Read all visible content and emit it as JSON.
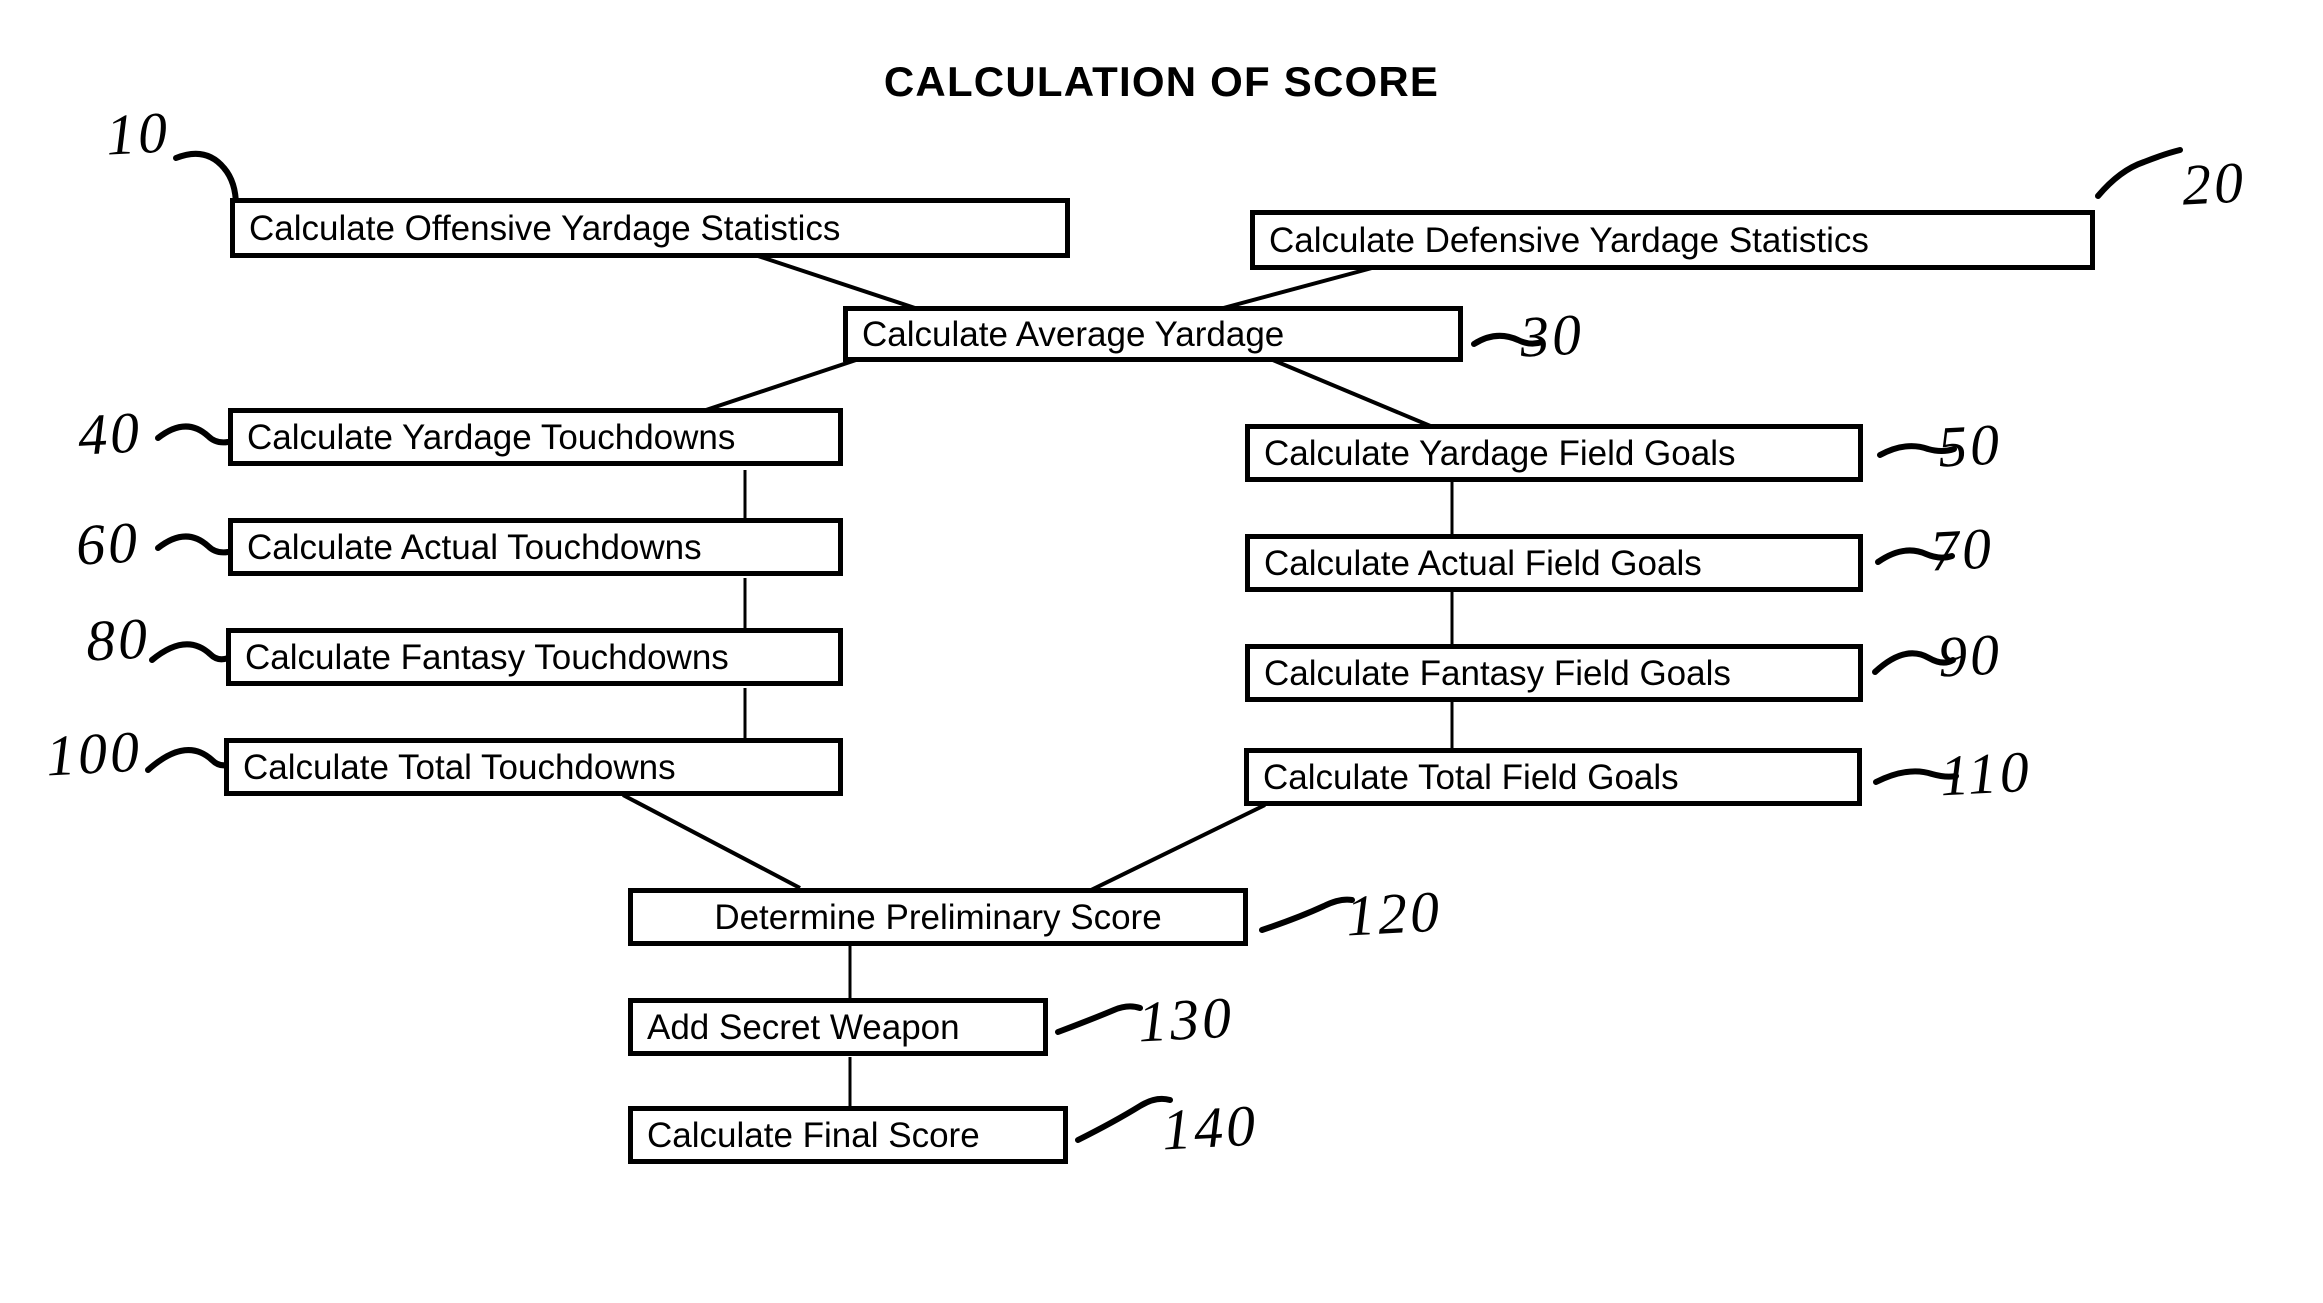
{
  "diagram": {
    "title": "CALCULATION OF SCORE",
    "type": "flowchart",
    "style": "patent-drawing",
    "ink_color": "#000000",
    "background_color": "#ffffff"
  },
  "nodes": [
    {
      "id": "n10",
      "ref": "10",
      "label": "Calculate Offensive Yardage Statistics",
      "column": "left",
      "row": 1
    },
    {
      "id": "n20",
      "ref": "20",
      "label": "Calculate Defensive Yardage Statistics",
      "column": "right",
      "row": 1
    },
    {
      "id": "n30",
      "ref": "30",
      "label": "Calculate Average Yardage",
      "column": "center",
      "row": 2
    },
    {
      "id": "n40",
      "ref": "40",
      "label": "Calculate Yardage Touchdowns",
      "column": "left",
      "row": 3
    },
    {
      "id": "n50",
      "ref": "50",
      "label": "Calculate Yardage Field Goals",
      "column": "right",
      "row": 3
    },
    {
      "id": "n60",
      "ref": "60",
      "label": "Calculate Actual Touchdowns",
      "column": "left",
      "row": 4
    },
    {
      "id": "n70",
      "ref": "70",
      "label": "Calculate Actual Field Goals",
      "column": "right",
      "row": 4
    },
    {
      "id": "n80",
      "ref": "80",
      "label": "Calculate Fantasy Touchdowns",
      "column": "left",
      "row": 5
    },
    {
      "id": "n90",
      "ref": "90",
      "label": "Calculate Fantasy Field Goals",
      "column": "right",
      "row": 5
    },
    {
      "id": "n100",
      "ref": "100",
      "label": "Calculate Total Touchdowns",
      "column": "left",
      "row": 6
    },
    {
      "id": "n110",
      "ref": "110",
      "label": "Calculate Total Field Goals",
      "column": "right",
      "row": 6
    },
    {
      "id": "n120",
      "ref": "120",
      "label": "Determine Preliminary Score",
      "column": "center",
      "row": 7
    },
    {
      "id": "n130",
      "ref": "130",
      "label": "Add Secret Weapon",
      "column": "center",
      "row": 8
    },
    {
      "id": "n140",
      "ref": "140",
      "label": "Calculate Final Score",
      "column": "center",
      "row": 9
    }
  ],
  "edges": [
    {
      "from": "n10",
      "to": "n30"
    },
    {
      "from": "n20",
      "to": "n30"
    },
    {
      "from": "n30",
      "to": "n40"
    },
    {
      "from": "n30",
      "to": "n50"
    },
    {
      "from": "n40",
      "to": "n60"
    },
    {
      "from": "n60",
      "to": "n80"
    },
    {
      "from": "n80",
      "to": "n100"
    },
    {
      "from": "n50",
      "to": "n70"
    },
    {
      "from": "n70",
      "to": "n90"
    },
    {
      "from": "n90",
      "to": "n110"
    },
    {
      "from": "n100",
      "to": "n120"
    },
    {
      "from": "n110",
      "to": "n120"
    },
    {
      "from": "n120",
      "to": "n130"
    },
    {
      "from": "n130",
      "to": "n140"
    }
  ]
}
